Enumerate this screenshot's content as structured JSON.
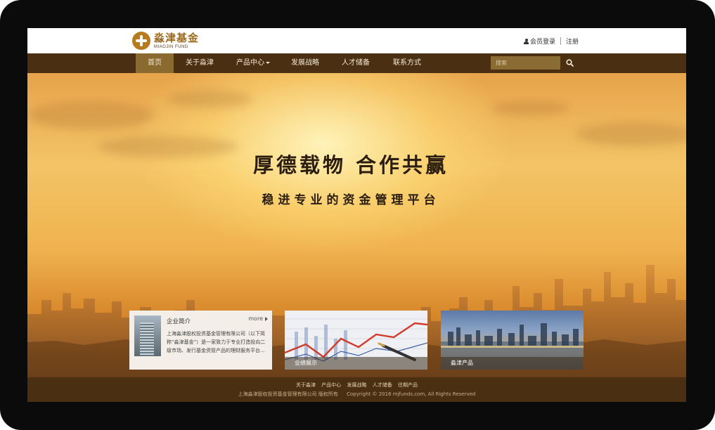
{
  "header": {
    "logo_cn": "淼津基金",
    "logo_en": "MIAOJIN FUND",
    "login_label": "会员登录",
    "register_label": "注册"
  },
  "nav": {
    "items": [
      {
        "label": "首页"
      },
      {
        "label": "关于淼津"
      },
      {
        "label": "产品中心"
      },
      {
        "label": "发展战略"
      },
      {
        "label": "人才储备"
      },
      {
        "label": "联系方式"
      }
    ],
    "active_index": 0,
    "search_placeholder": "搜索"
  },
  "hero": {
    "title": "厚德载物 合作共赢",
    "subtitle": "稳进专业的资金管理平台"
  },
  "cards": {
    "intro": {
      "title": "企业简介",
      "more_label": "more",
      "text": "上海淼津股权投资基金管理有限公司（以下简称“淼津基金”）是一家致力于专业打造投向二级市场、发行基金资管产品的理财服务平台..."
    },
    "performance": {
      "caption": "业绩展示"
    },
    "products": {
      "caption": "淼津产品"
    }
  },
  "footer": {
    "links": [
      "关于淼津",
      "产品中心",
      "发展战略",
      "人才储备",
      "往期产品"
    ],
    "company": "上海淼津股权投资基金管理有限公司 版权所有",
    "copyright": "Copyright © 2016 mjfunds.com, All Rights Reserved"
  },
  "colors": {
    "nav_bg": "#4a2f12",
    "nav_active": "#8b6a30",
    "brand_gold": "#9a6a1d",
    "hero_gold": "#f3c466"
  }
}
